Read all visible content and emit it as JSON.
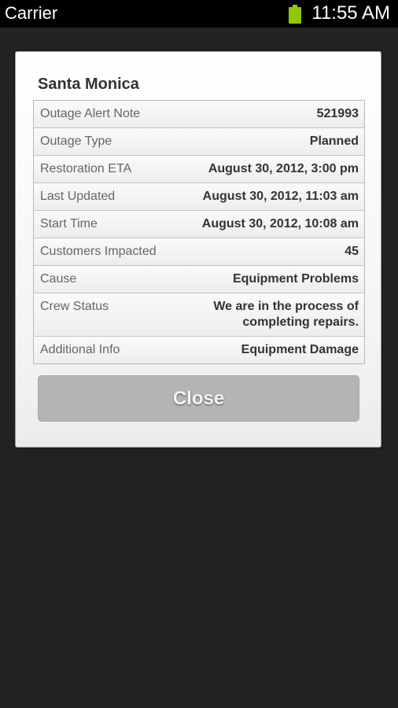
{
  "status_bar": {
    "carrier": "Carrier",
    "time": "11:55 AM",
    "battery_icon": "battery-icon",
    "battery_color": "#8fc800"
  },
  "dialog": {
    "title": "Santa Monica",
    "rows": [
      {
        "label": "Outage Alert Note",
        "value": "521993"
      },
      {
        "label": "Outage Type",
        "value": "Planned"
      },
      {
        "label": "Restoration ETA",
        "value": "August 30, 2012, 3:00 pm"
      },
      {
        "label": "Last Updated",
        "value": "August 30, 2012, 11:03 am"
      },
      {
        "label": "Start Time",
        "value": "August 30, 2012, 10:08 am"
      },
      {
        "label": "Customers Impacted",
        "value": "45"
      },
      {
        "label": "Cause",
        "value": "Equipment Problems"
      },
      {
        "label": "Crew Status",
        "value": "We are in the process of completing repairs."
      },
      {
        "label": "Additional Info",
        "value": "Equipment Damage"
      }
    ],
    "close_label": "Close"
  },
  "colors": {
    "background": "#222222",
    "status_bar": "#000000",
    "button": "#b4b4b4"
  }
}
